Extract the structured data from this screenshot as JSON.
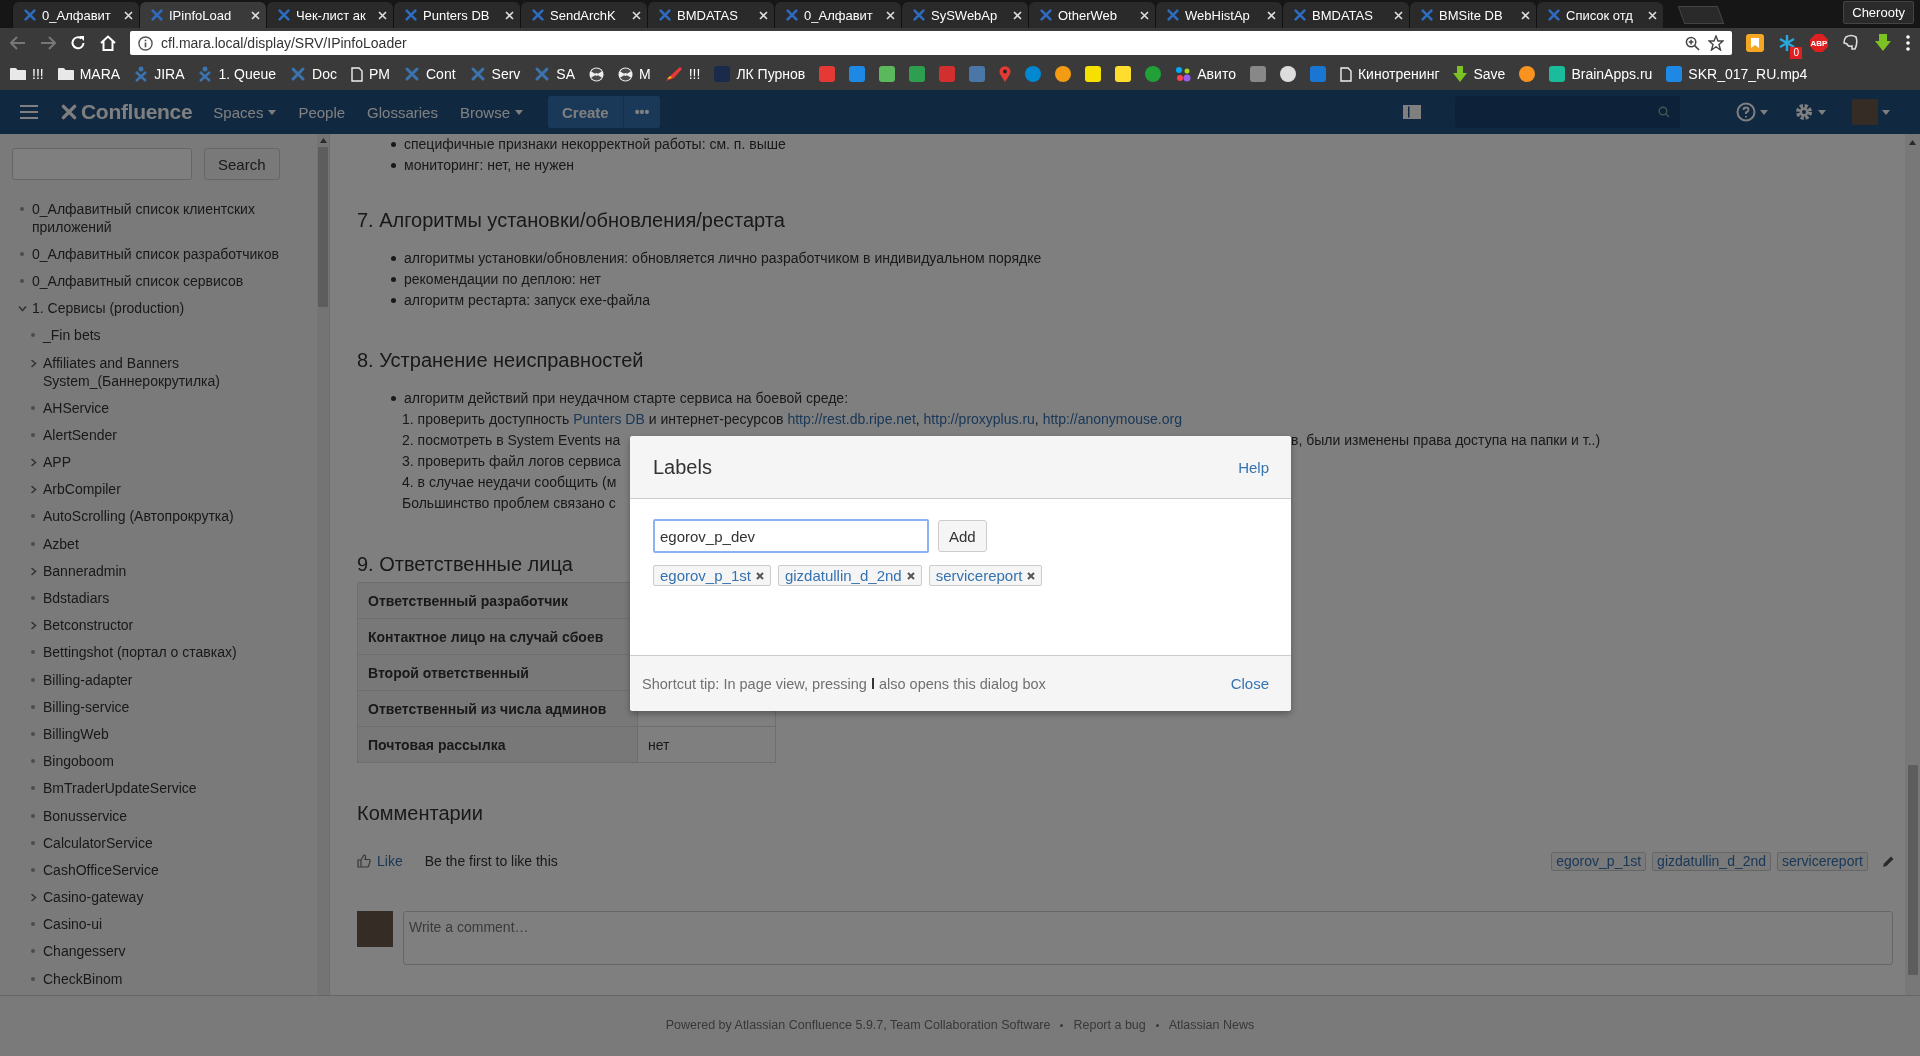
{
  "browser": {
    "tabs": [
      {
        "title": "0_Алфавит",
        "selected": false
      },
      {
        "title": "IPinfoLoad",
        "selected": true
      },
      {
        "title": "Чек-лист ак",
        "selected": false
      },
      {
        "title": "Punters DB",
        "selected": false
      },
      {
        "title": "SendArchK",
        "selected": false
      },
      {
        "title": "BMDATAS",
        "selected": false
      },
      {
        "title": "0_Алфавит",
        "selected": false
      },
      {
        "title": "SySWebAp",
        "selected": false
      },
      {
        "title": "OtherWeb",
        "selected": false
      },
      {
        "title": "WebHistAp",
        "selected": false
      },
      {
        "title": "BMDATAS",
        "selected": false
      },
      {
        "title": "BMSite DB",
        "selected": false
      },
      {
        "title": "Список отд",
        "selected": false
      }
    ],
    "profile": "Cherooty",
    "url": "cfl.mara.local/display/SRV/IPinfoLoader",
    "extensions": [
      {
        "kind": "bookmark"
      },
      {
        "kind": "snowflake",
        "badge": "0"
      },
      {
        "kind": "adblock",
        "label": "ABP"
      },
      {
        "kind": "elephant"
      },
      {
        "kind": "download"
      }
    ],
    "bookmarks": [
      {
        "kind": "folder",
        "label": "!!!"
      },
      {
        "kind": "folder",
        "label": "MARA"
      },
      {
        "kind": "jira",
        "label": "JIRA"
      },
      {
        "kind": "jira",
        "label": "1. Queue"
      },
      {
        "kind": "cross",
        "label": "Doc"
      },
      {
        "kind": "page",
        "label": "PM"
      },
      {
        "kind": "cross",
        "label": "Cont"
      },
      {
        "kind": "cross",
        "label": "Serv"
      },
      {
        "kind": "cross",
        "label": "SA"
      },
      {
        "kind": "radiation"
      },
      {
        "kind": "radiation",
        "label": "M"
      },
      {
        "kind": "rocket",
        "label": "!!!"
      },
      {
        "kind": "square",
        "color": "#1a2a4a",
        "label": "ЛК Пурнов"
      },
      {
        "kind": "square",
        "color": "#e53935"
      },
      {
        "kind": "square",
        "color": "#1e88e5"
      },
      {
        "kind": "square",
        "color": "#5cb85c"
      },
      {
        "kind": "square",
        "color": "#2e9e4f"
      },
      {
        "kind": "square",
        "color": "#d32f2f"
      },
      {
        "kind": "square",
        "color": "#4a76a8"
      },
      {
        "kind": "pin",
        "color": "#e53935"
      },
      {
        "kind": "circle",
        "color": "#0288d1"
      },
      {
        "kind": "circle",
        "color": "#f39c12"
      },
      {
        "kind": "square",
        "color": "#f5e000"
      },
      {
        "kind": "square",
        "color": "#ffdd2d"
      },
      {
        "kind": "circle",
        "color": "#21a038"
      },
      {
        "kind": "dots",
        "label": "Авито"
      },
      {
        "kind": "square",
        "color": "#888888"
      },
      {
        "kind": "circle",
        "color": "#dddddd"
      },
      {
        "kind": "square",
        "color": "#1976d2"
      },
      {
        "kind": "page",
        "label": "Кинотренинг"
      },
      {
        "kind": "arrow",
        "label": "Save"
      },
      {
        "kind": "circle",
        "color": "#f7931e"
      },
      {
        "kind": "square",
        "color": "#1abc9c",
        "label": "BrainApps.ru"
      },
      {
        "kind": "square",
        "color": "#1e88e5",
        "label": "SKR_017_RU.mp4"
      }
    ]
  },
  "header": {
    "logo": "Confluence",
    "nav": [
      {
        "label": "Spaces",
        "dropdown": true
      },
      {
        "label": "People",
        "dropdown": false
      },
      {
        "label": "Glossaries",
        "dropdown": false
      },
      {
        "label": "Browse",
        "dropdown": true
      }
    ],
    "create": "Create",
    "more": "•••"
  },
  "sidebar": {
    "search_button": "Search",
    "tree": [
      {
        "label": "0_Алфавитный список клиентских приложений",
        "kind": "leaf"
      },
      {
        "label": "0_Алфавитный список разработчиков",
        "kind": "leaf"
      },
      {
        "label": "0_Алфавитный список сервисов",
        "kind": "leaf"
      },
      {
        "label": "1. Сервисы (production)",
        "kind": "branch",
        "expanded": true,
        "children": [
          {
            "label": "_Fin bets",
            "kind": "leaf"
          },
          {
            "label": "Affiliates and Banners System_(Баннерокрутилка)",
            "kind": "branch",
            "expanded": false
          },
          {
            "label": "AHService",
            "kind": "leaf"
          },
          {
            "label": "AlertSender",
            "kind": "leaf"
          },
          {
            "label": "APP",
            "kind": "branch",
            "expanded": false
          },
          {
            "label": "ArbCompiler",
            "kind": "branch",
            "expanded": false
          },
          {
            "label": "AutoScrolling (Автопрокрутка)",
            "kind": "leaf"
          },
          {
            "label": "Azbet",
            "kind": "leaf"
          },
          {
            "label": "Banneradmin",
            "kind": "branch",
            "expanded": false
          },
          {
            "label": "Bdstadiars",
            "kind": "leaf"
          },
          {
            "label": "Betconstructor",
            "kind": "branch",
            "expanded": false
          },
          {
            "label": "Bettingshot (портал о ставках)",
            "kind": "leaf"
          },
          {
            "label": "Billing-adapter",
            "kind": "leaf"
          },
          {
            "label": "Billing-service",
            "kind": "leaf"
          },
          {
            "label": "BillingWeb",
            "kind": "leaf"
          },
          {
            "label": "Bingoboom",
            "kind": "leaf"
          },
          {
            "label": "BmTraderUpdateService",
            "kind": "leaf"
          },
          {
            "label": "Bonusservice",
            "kind": "leaf"
          },
          {
            "label": "CalculatorService",
            "kind": "leaf"
          },
          {
            "label": "CashOfficeService",
            "kind": "leaf"
          },
          {
            "label": "Casino-gateway",
            "kind": "branch",
            "expanded": false
          },
          {
            "label": "Casino-ui",
            "kind": "leaf"
          },
          {
            "label": "Changesserv",
            "kind": "leaf"
          },
          {
            "label": "CheckBinom",
            "kind": "leaf"
          }
        ]
      }
    ]
  },
  "content": {
    "intro_bullets": [
      "специфичные признаки некорректной работы: см. п. выше",
      "мониторинг: нет, не нужен"
    ],
    "section_7": {
      "heading": "7. Алгоритмы установки/обновления/рестарта",
      "bullets": [
        "алгоритмы установки/обновления: обновляется лично разработчиком в индивидуальном порядке",
        "рекомендации по деплою: нет",
        "алгоритм рестарта:  запуск exe-файла"
      ]
    },
    "section_8": {
      "heading": "8. Устранение неисправностей",
      "bullet": "алгоритм действий при неудачном старте сервиса на боевой среде:",
      "step_1": [
        {
          "text": "1. проверить доступность "
        },
        {
          "link": "Punters DB"
        },
        {
          "text": " и интернет-ресурсов "
        },
        {
          "link": "http://rest.db.ripe.net"
        },
        {
          "text": ", "
        },
        {
          "link": "http://proxyplus.ru"
        },
        {
          "text": ", "
        },
        {
          "link": "http://anonymouse.org"
        }
      ],
      "partial_lines": [
        {
          "left": "2. посмотреть в System Events на",
          "right": "в, были изменены права доступа на папки и т..)"
        },
        {
          "left": "3. проверить файл логов сервиса"
        },
        {
          "left": "4. в случае неудачи сообщить (м"
        },
        {
          "left": "Большинство проблем связано с"
        }
      ]
    },
    "section_9": {
      "heading": "9. Ответственные лица",
      "rows": [
        {
          "label": "Ответственный разработчик"
        },
        {
          "label": "Контактное лицо на случай сбоев"
        },
        {
          "label": "Второй ответственный"
        },
        {
          "label": "Ответственный из числа админов"
        },
        {
          "label": "Почтовая рассылка",
          "value": "нет"
        }
      ]
    }
  },
  "comments": {
    "heading": "Комментарии",
    "like": "Like",
    "like_note": "Be the first to like this",
    "labels": [
      "egorov_p_1st",
      "gizdatullin_d_2nd",
      "servicereport"
    ],
    "placeholder": "Write a comment…"
  },
  "footer": {
    "links": [
      "Powered by Atlassian Confluence 5.9.7, Team Collaboration Software",
      "Report a bug",
      "Atlassian News"
    ]
  },
  "dialog": {
    "title": "Labels",
    "help": "Help",
    "input_value": "egorov_p_dev",
    "add": "Add",
    "labels": [
      "egorov_p_1st",
      "gizdatullin_d_2nd",
      "servicereport"
    ],
    "tip": "Shortcut tip: In page view, pressing **l** also opens this dialog box",
    "close": "Close"
  }
}
